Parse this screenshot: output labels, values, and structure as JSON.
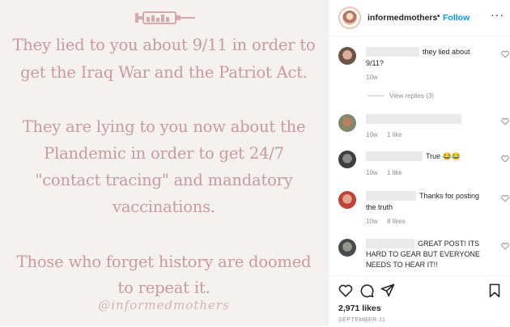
{
  "post": {
    "paragraph1_line1": "They lied to you about 9/11 in order to",
    "paragraph1_line2": "get the Iraq War and the Patriot Act.",
    "paragraph2_line1": "They are lying to you now about the",
    "paragraph2_line2": "Plandemic in order to get 24/7",
    "paragraph2_line3": "\"contact tracing\" and mandatory",
    "paragraph2_line4": "vaccinations.",
    "paragraph3_line1": "Those who forget history are doomed",
    "paragraph3_line2": "to repeat it.",
    "signature": "@informedmothers",
    "text_color": "#c99a9e",
    "background_color": "#f5f1ee"
  },
  "header": {
    "username": "informedmothers",
    "separator": "•",
    "follow_label": "Follow",
    "more_label": "···"
  },
  "comments": [
    {
      "text_line1": "they lied about",
      "text_line2": "9/11?",
      "age": "10w",
      "likes": "",
      "replies_label": "View replies (3)"
    },
    {
      "text_line1": "",
      "text_line2": "",
      "age": "10w",
      "likes": "1 like"
    },
    {
      "text_line1": "True 😂😂",
      "text_line2": "",
      "age": "10w",
      "likes": "1 like"
    },
    {
      "text_line1": "Thanks for posting",
      "text_line2": "the truth",
      "age": "10w",
      "likes": "8 likes"
    },
    {
      "text_line1": "GREAT POST! ITS",
      "text_line2": "HARD TO GEAR BUT EVERYONE",
      "text_line3": "NEEDS TO HEAR IT!!"
    }
  ],
  "footer": {
    "likes_count": "2,971 likes",
    "date": "SEPTEMBER 11"
  },
  "icons": {
    "like": "heart-icon",
    "comment": "comment-icon",
    "share": "share-icon",
    "save": "bookmark-icon"
  },
  "colors": {
    "accent": "#0095f6",
    "text": "#262626",
    "muted": "#8e8e8e"
  }
}
